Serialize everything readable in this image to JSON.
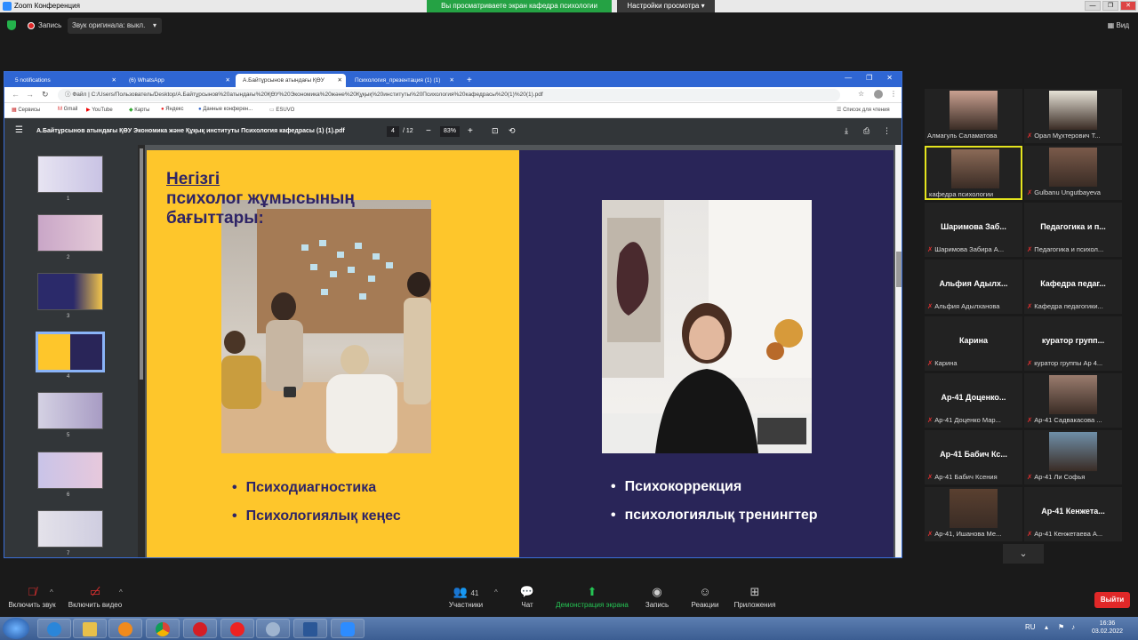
{
  "zoom": {
    "window_title": "Zoom Конференция",
    "share_banner": "Вы просматриваете экран кафедра психологии",
    "view_settings": "Настройки просмотра ▾",
    "record_label": "Запись",
    "original_sound": "Звук оригинала: выкл.",
    "view_label": "Вид",
    "window_buttons": [
      "—",
      "❐",
      "✕"
    ]
  },
  "browser": {
    "tabs": [
      {
        "label": "5 notifications",
        "active": false
      },
      {
        "label": "(6) WhatsApp",
        "active": false
      },
      {
        "label": "А.Байтұрсынов атындағы ҚӨУ",
        "active": true
      },
      {
        "label": "Психология_презентация (1) (1)",
        "active": false
      }
    ],
    "address_prefix": "Файл",
    "address": "C:/Users/Пользователь/Desktop/А.Байтұрсынов%20атындағы%20ҚӨУ%20Экономика%20және%20Құқық%20институты%20Психология%20кафедрасы%20(1)%20(1).pdf",
    "bookmarks": [
      "Сервисы",
      "Gmail",
      "YouTube",
      "Карты",
      "Яндекс",
      "Данные конферен...",
      "ESUVO"
    ],
    "reading_list": "Список для чтения",
    "window_buttons": [
      "—",
      "❐",
      "✕"
    ]
  },
  "pdf": {
    "title": "А.Байтұрсынов атындағы ҚӨУ Экономика және Құқық институты Психология кафедрасы (1) (1).pdf",
    "current_page": "4",
    "total_pages": "/ 12",
    "zoom": "83%",
    "thumbnails": [
      "1",
      "2",
      "3",
      "4",
      "5",
      "6",
      "7"
    ],
    "selected_thumbnail": "4"
  },
  "slide": {
    "title_line1": "Негізгі",
    "title_line2": "психолог жұмысының",
    "title_line3": "бағыттары:",
    "left_bullets": [
      "Психодиагностика",
      "Психологиялық кеңес"
    ],
    "right_bullets": [
      "Психокоррекция",
      "психологиялық тренингтер"
    ]
  },
  "participants": [
    {
      "big": "",
      "name": "Алмагуль Саламатова",
      "muted": false,
      "photo": true
    },
    {
      "big": "",
      "name": "Орал Мұхтерович Т...",
      "muted": true,
      "photo": true
    },
    {
      "big": "",
      "name": "кафедра психологии",
      "muted": false,
      "photo": true,
      "active": true
    },
    {
      "big": "",
      "name": "Gulbanu Ungutbayeva",
      "muted": true,
      "photo": true
    },
    {
      "big": "Шаримова Заб...",
      "name": "Шаримова Забира А...",
      "muted": true
    },
    {
      "big": "Педагогика и п...",
      "name": "Педагогика и психол...",
      "muted": true
    },
    {
      "big": "Альфия Адылх...",
      "name": "Альфия Адылханова",
      "muted": true
    },
    {
      "big": "Кафедра педаг...",
      "name": "Кафедра педагогики...",
      "muted": true
    },
    {
      "big": "Карина",
      "name": "Карина",
      "muted": true
    },
    {
      "big": "куратор групп...",
      "name": "куратор группы Ар 4...",
      "muted": true
    },
    {
      "big": "Ар-41 Доценко...",
      "name": "Ар-41 Доценко Мар...",
      "muted": true
    },
    {
      "big": "",
      "name": "Ар-41 Садвакасова ...",
      "muted": true,
      "photo": true
    },
    {
      "big": "Ар-41 Бабич Кс...",
      "name": "Ар-41 Бабич Ксения",
      "muted": true
    },
    {
      "big": "",
      "name": "Ар-41 Ли Софья",
      "muted": true,
      "photo": true
    },
    {
      "big": "",
      "name": "Ар-41, Ишанова Ме...",
      "muted": true,
      "photo": true
    },
    {
      "big": "Ар-41 Кенжета...",
      "name": "Ар-41 Кенжетаева А...",
      "muted": true
    }
  ],
  "controls": {
    "unmute": "Включить звук",
    "start_video": "Включить видео",
    "participants": "Участники",
    "participants_count": "41",
    "chat": "Чат",
    "share": "Демонстрация экрана",
    "record": "Запись",
    "reactions": "Реакции",
    "apps": "Приложения",
    "leave": "Выйти"
  },
  "taskbar": {
    "lang": "RU",
    "time": "16:36",
    "date": "03.02.2022"
  }
}
